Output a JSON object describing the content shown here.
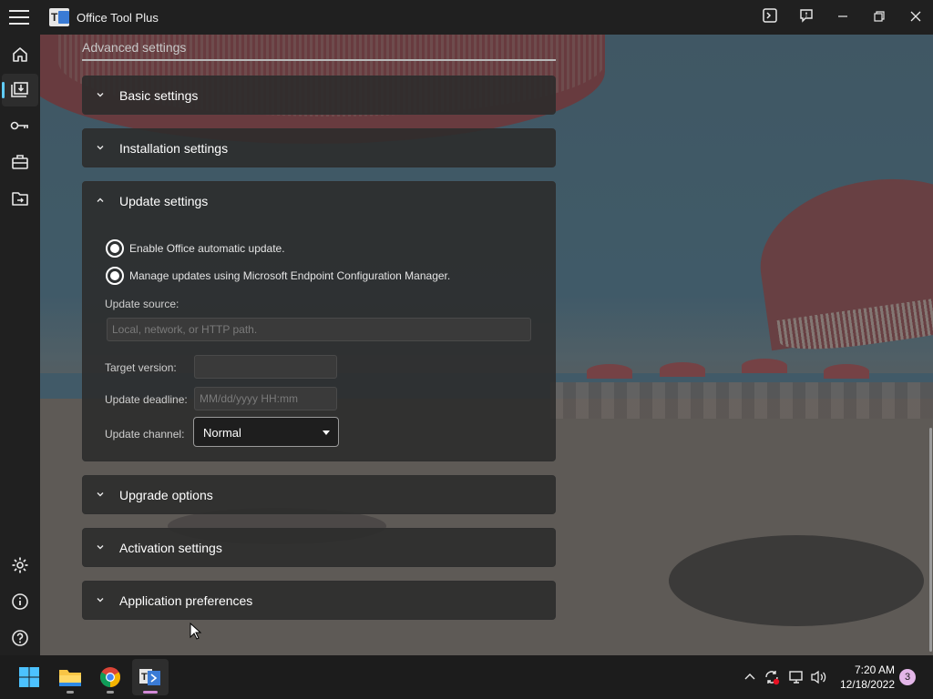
{
  "window": {
    "title": "Office Tool Plus",
    "logo_text": "T",
    "icons": [
      "hamburger-menu-icon",
      "console-icon",
      "feedback-icon",
      "minimize-icon",
      "restore-icon",
      "close-icon"
    ]
  },
  "nav": {
    "items": [
      {
        "name": "home",
        "icon": "home-icon"
      },
      {
        "name": "deploy",
        "icon": "deploy-icon",
        "active": true
      },
      {
        "name": "activation",
        "icon": "key-icon"
      },
      {
        "name": "toolbox",
        "icon": "toolbox-icon"
      },
      {
        "name": "convert",
        "icon": "folder-arrow-icon"
      },
      {
        "name": "settings",
        "icon": "gear-icon"
      },
      {
        "name": "about",
        "icon": "info-icon"
      },
      {
        "name": "help",
        "icon": "question-icon"
      }
    ]
  },
  "content": {
    "section_header": "Advanced settings",
    "panels": [
      {
        "title": "Basic settings",
        "expanded": false
      },
      {
        "title": "Installation settings",
        "expanded": false
      },
      {
        "title": "Update settings",
        "expanded": true
      },
      {
        "title": "Upgrade options",
        "expanded": false
      },
      {
        "title": "Activation settings",
        "expanded": false
      },
      {
        "title": "Application preferences",
        "expanded": false
      }
    ],
    "update": {
      "radio_auto_update": "Enable Office automatic update.",
      "radio_sccm": "Manage updates using Microsoft Endpoint Configuration Manager.",
      "source_label": "Update source:",
      "source_value": "",
      "source_placeholder": "Local, network, or HTTP path.",
      "target_label": "Target version:",
      "target_value": "",
      "deadline_label": "Update deadline:",
      "deadline_value": "",
      "deadline_placeholder": "MM/dd/yyyy HH:mm",
      "channel_label": "Update channel:",
      "channel_value": "Normal"
    }
  },
  "taskbar": {
    "apps": [
      {
        "name": "start",
        "icon": "windows-start-icon"
      },
      {
        "name": "file-explorer",
        "icon": "folder-icon"
      },
      {
        "name": "chrome",
        "icon": "chrome-icon"
      },
      {
        "name": "office-tool-plus",
        "icon": "office-tool-plus-icon",
        "active": true
      }
    ],
    "tray_icons": [
      "chevron-up-icon",
      "sync-icon",
      "network-icon",
      "volume-icon"
    ],
    "time": "7:20 AM",
    "date": "12/18/2022",
    "notification_count": "3"
  },
  "colors": {
    "accent": "#60cdff",
    "background": "#202020",
    "panel": "#2b2b2b",
    "taskbar_active_indicator": "#d38ad9"
  }
}
